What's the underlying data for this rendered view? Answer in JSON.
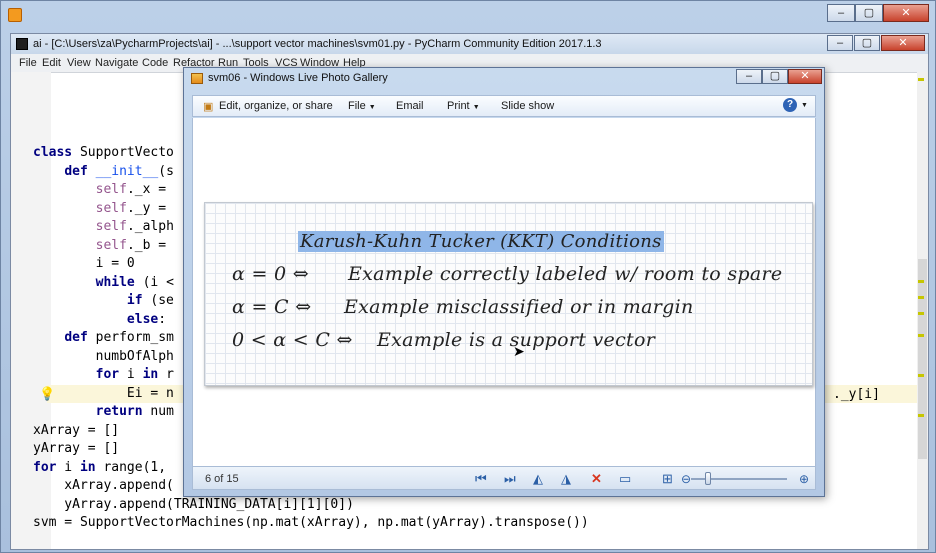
{
  "outer_window": {
    "title": ""
  },
  "pycharm": {
    "title": "ai - [C:\\Users\\za\\PycharmProjects\\ai] - ...\\support vector machines\\svm01.py - PyCharm Community Edition 2017.1.3",
    "menu": [
      "File",
      "Edit",
      "View",
      "Navigate",
      "Code",
      "Refactor",
      "Run",
      "Tools",
      "VCS",
      "Window",
      "Help"
    ],
    "code_lines": [
      "class SupportVecto",
      "    def __init__(s",
      "        self._x =",
      "        self._y =",
      "        self._alph",
      "        self._b =",
      "        i = 0",
      "        while (i <",
      "            if (se",
      "            else:",
      "    def perform_sm",
      "        numbOfAlph",
      "        for i in r",
      "            Ei = n",
      "        return num",
      "xArray = []",
      "yArray = []",
      "for i in range(1,",
      "    xArray.append(",
      "    yArray.append(TRAINING_DATA[i][1][0])",
      "svm = SupportVectorMachines(np.mat(xArray), np.mat(yArray).transpose())"
    ],
    "right_fragment": "._y[i]"
  },
  "photo_gallery": {
    "title": "svm06 - Windows Live Photo Gallery",
    "toolbar": {
      "edit": "Edit, organize, or share",
      "file": "File",
      "email": "Email",
      "print": "Print",
      "slideshow": "Slide show"
    },
    "slide": {
      "title": "Karush-Kuhn Tucker (KKT) Conditions",
      "row1_cond": "α = 0  ⇔",
      "row1_text": "Example correctly labeled w/ room to spare",
      "row2_cond": "α = C  ⇔",
      "row2_text": "Example misclassified or in margin",
      "row3_cond": "0 < α < C  ⇔",
      "row3_text": "Example is a support vector"
    },
    "status": {
      "count": "6 of 15"
    }
  },
  "colors": {
    "accent": "#8fb6e8",
    "keyword": "#000080",
    "self": "#94558d"
  }
}
